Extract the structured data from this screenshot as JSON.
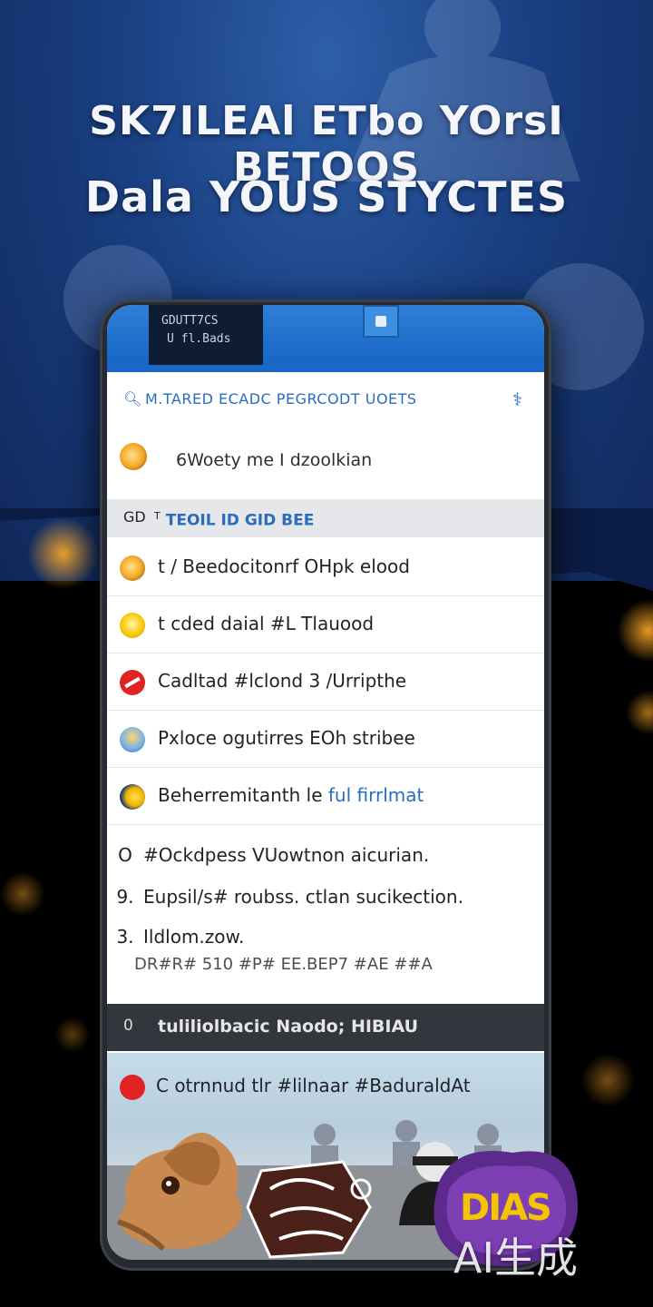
{
  "promo": {
    "headline_line1": "SK7ILEAl  ETbo YOrsI  BETOOS",
    "headline_line2": "Dala  YOUS STYCTES"
  },
  "status_card": {
    "line1": "GDUTT7CS",
    "line2": "U  fl.Bads"
  },
  "search": {
    "placeholder": "M.TARED  ECADC PEGRCODT UOETS"
  },
  "first_item": {
    "label": "6Woety me I dzoolkian"
  },
  "section": {
    "label": "TEOIL  ID  GID BEE",
    "icon_label": "GD",
    "marker": "T"
  },
  "rows": [
    {
      "label": "t / Beedocitonrf OHpk elood",
      "icon": "egg-emoji-icon",
      "accent": ""
    },
    {
      "label": "t  cded daial  #L  Tlauood",
      "icon": "smiley-emoji-icon",
      "accent": ""
    },
    {
      "label": "Cadltad #lclond 3 /Urripthe",
      "icon": "red-mark-icon",
      "accent": ""
    },
    {
      "label": "Pxloce  ogutirres EOh stribee",
      "icon": "sun-cloud-icon",
      "accent": ""
    },
    {
      "label": "Beherremitanth le ",
      "icon": "moon-icon",
      "accent": "ful firrlmat"
    }
  ],
  "list_block": [
    {
      "bullet": "O",
      "text": "#Ockdpess VUowtnon  aicurian."
    },
    {
      "bullet": "9.",
      "text": "Eupsil/s# roubss. ctlan sucikection."
    },
    {
      "bullet": "3.",
      "text": "Ildlom.zow."
    },
    {
      "bullet": "",
      "text": "DR#R#  510  #P#  EE.BEP7      #AE  ##A"
    }
  ],
  "dark_band": {
    "icon": "0",
    "label": "tuliliolbacic  Naodo; HIBIAU"
  },
  "photo_row": {
    "label": "C otrnnud  tlr  #lilnaar  #BaduraldAt"
  },
  "sticker_text": "DIAS",
  "watermark": "AI生成",
  "colors": {
    "header_blue": "#1a68c8",
    "accent_blue": "#2a6dbd",
    "background_dark": "#000000",
    "band_dark": "#33373d",
    "red": "#e02424"
  }
}
